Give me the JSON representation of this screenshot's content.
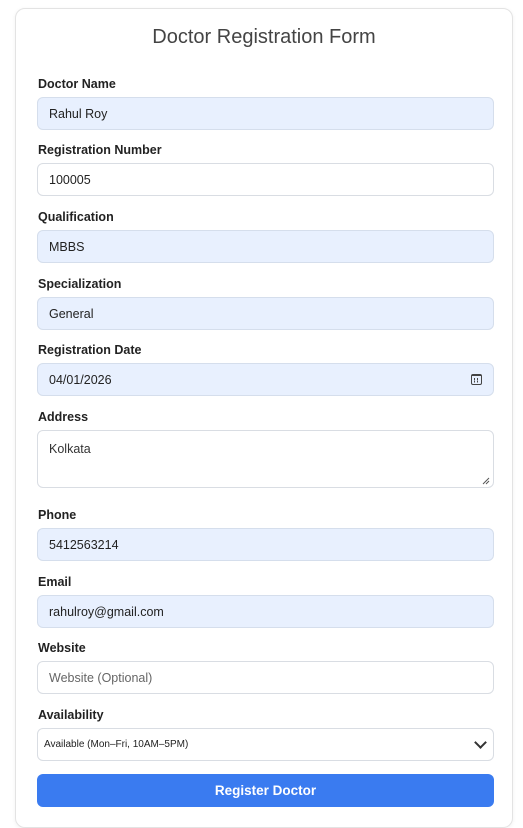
{
  "form": {
    "title": "Doctor Registration Form",
    "doctor_name": {
      "label": "Doctor Name",
      "value": "Rahul Roy"
    },
    "registration_number": {
      "label": "Registration Number",
      "value": "100005"
    },
    "qualification": {
      "label": "Qualification",
      "value": "MBBS"
    },
    "specialization": {
      "label": "Specialization",
      "value": "General"
    },
    "registration_date": {
      "label": "Registration Date",
      "value": "04/01/2026"
    },
    "address": {
      "label": "Address",
      "value": "Kolkata"
    },
    "phone": {
      "label": "Phone",
      "value": "5412563214"
    },
    "email": {
      "label": "Email",
      "value": "rahulroy@gmail.com"
    },
    "website": {
      "label": "Website",
      "value": "",
      "placeholder": "Website (Optional)"
    },
    "availability": {
      "label": "Availability",
      "selected": "Available (Mon–Fri, 10AM–5PM)"
    },
    "submit_label": "Register Doctor"
  },
  "colors": {
    "accent": "#3a7bf0",
    "autofill_bg": "#e8f0fe"
  },
  "icons": {
    "date": "calendar-icon",
    "select": "chevron-down-icon",
    "textarea": "resize-grip-icon"
  }
}
